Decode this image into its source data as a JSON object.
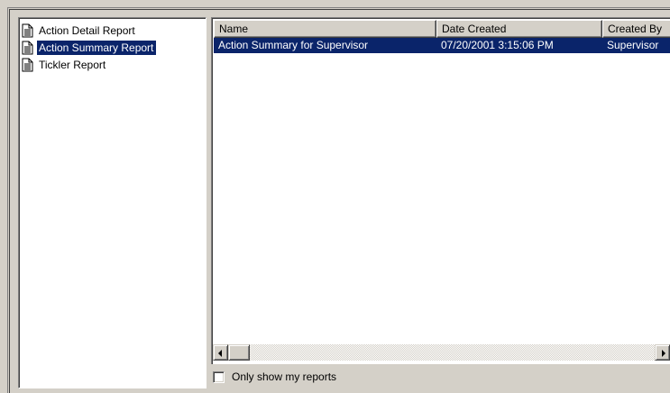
{
  "tree": {
    "items": [
      {
        "label": "Action Detail Report",
        "icon": "document-icon",
        "selected": false
      },
      {
        "label": "Action Summary Report",
        "icon": "document-icon",
        "selected": true
      },
      {
        "label": "Tickler Report",
        "icon": "document-icon",
        "selected": false
      }
    ]
  },
  "list": {
    "columns": [
      "Name",
      "Date Created",
      "Created By"
    ],
    "rows": [
      [
        "Action Summary for Supervisor",
        "07/20/2001 3:15:06 PM",
        "Supervisor"
      ]
    ]
  },
  "only_mine": {
    "label": "Only show my reports",
    "checked": false
  },
  "colors": {
    "selection": "#0a246a",
    "face": "#d4d0c8"
  }
}
